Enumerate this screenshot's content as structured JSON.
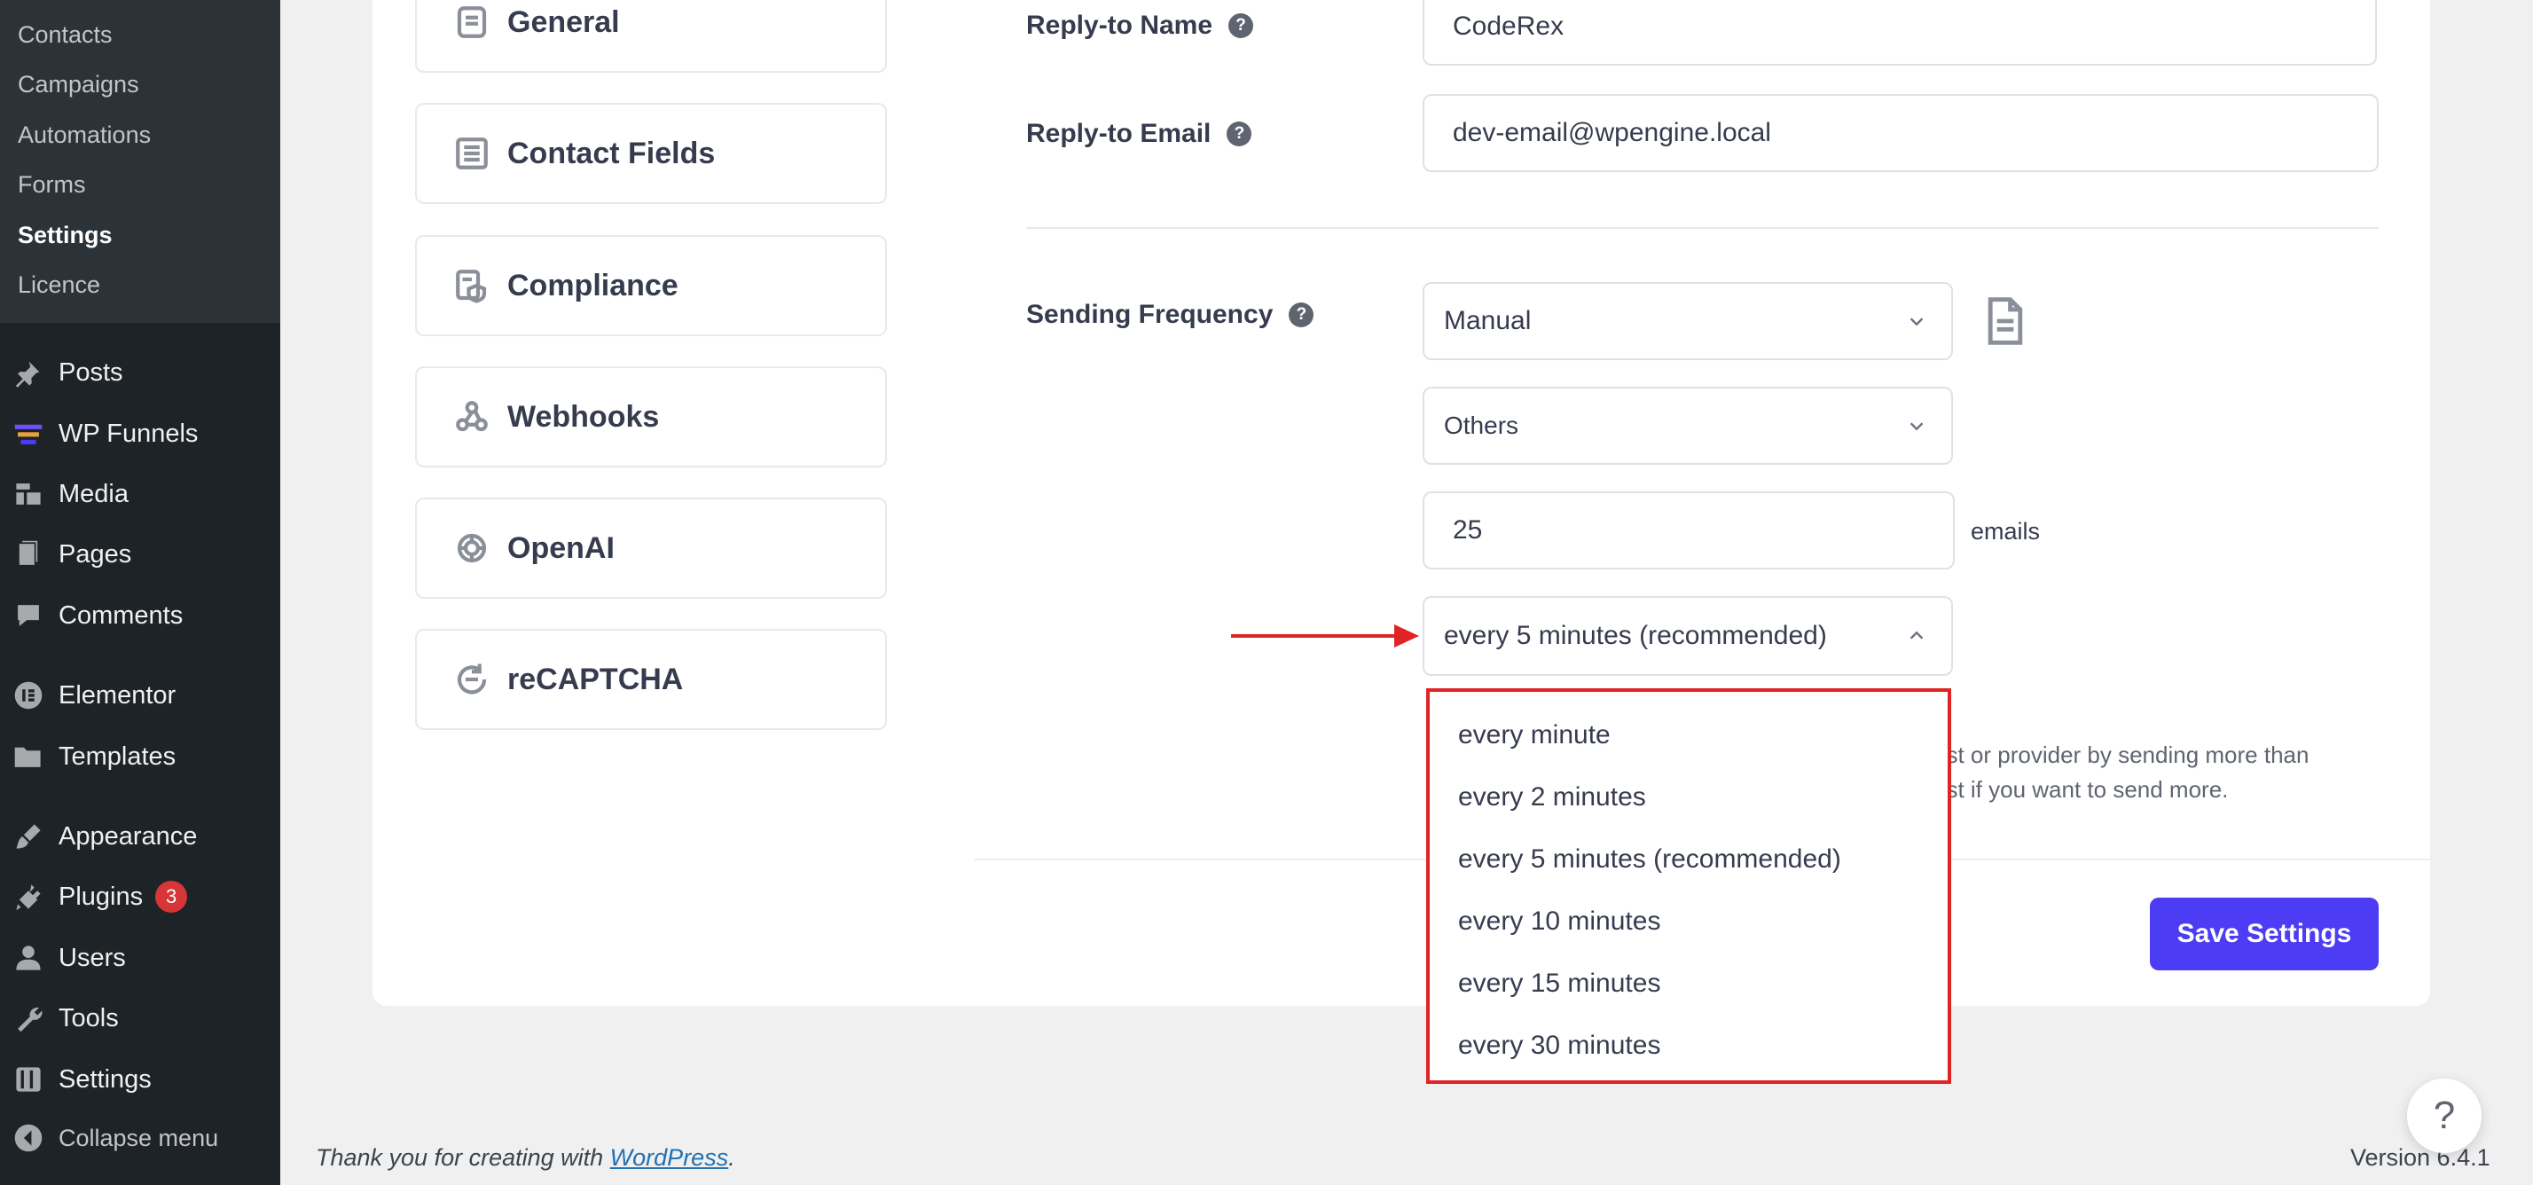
{
  "sidebar": {
    "submenu": [
      "Contacts",
      "Campaigns",
      "Automations",
      "Forms",
      "Settings",
      "Licence"
    ],
    "menu": [
      {
        "label": "Posts",
        "icon": "pin-icon"
      },
      {
        "label": "WP Funnels",
        "icon": "funnel-icon"
      },
      {
        "label": "Media",
        "icon": "media-icon"
      },
      {
        "label": "Pages",
        "icon": "pages-icon"
      },
      {
        "label": "Comments",
        "icon": "comments-icon"
      },
      {
        "label": "Elementor",
        "icon": "elementor-icon"
      },
      {
        "label": "Templates",
        "icon": "folder-icon"
      },
      {
        "label": "Appearance",
        "icon": "brush-icon"
      },
      {
        "label": "Plugins",
        "icon": "plugin-icon",
        "badge": "3"
      },
      {
        "label": "Users",
        "icon": "user-icon"
      },
      {
        "label": "Tools",
        "icon": "wrench-icon"
      },
      {
        "label": "Settings",
        "icon": "settings-icon"
      }
    ],
    "collapse": "Collapse menu"
  },
  "settings_nav": [
    "General",
    "Contact Fields",
    "Compliance",
    "Webhooks",
    "OpenAI",
    "reCAPTCHA"
  ],
  "form": {
    "reply_to_name_label": "Reply-to Name",
    "reply_to_name_value": "CodeRex",
    "reply_to_email_label": "Reply-to Email",
    "reply_to_email_value": "dev-email@wpengine.local",
    "help_glyph": "?",
    "sending_frequency_label": "Sending Frequency",
    "frequency_mode": "Manual",
    "provider": "Others",
    "email_count": "25",
    "emails_unit": "emails",
    "interval_selected": "every 5 minutes (recommended)",
    "note_line1": "ost or provider by sending more than",
    "note_line2": "ost if you want to send more."
  },
  "interval_options": [
    "every minute",
    "every 2 minutes",
    "every 5 minutes (recommended)",
    "every 10 minutes",
    "every 15 minutes",
    "every 30 minutes"
  ],
  "save_button": "Save Settings",
  "footer": {
    "thanks_prefix": "Thank you for creating with ",
    "thanks_link": "WordPress",
    "thanks_suffix": ".",
    "version": "Version 6.4.1"
  },
  "help_bubble": "?",
  "colors": {
    "sidebar_bg": "#1d2327",
    "accent": "#4c3cf4",
    "highlight": "#e02424"
  }
}
